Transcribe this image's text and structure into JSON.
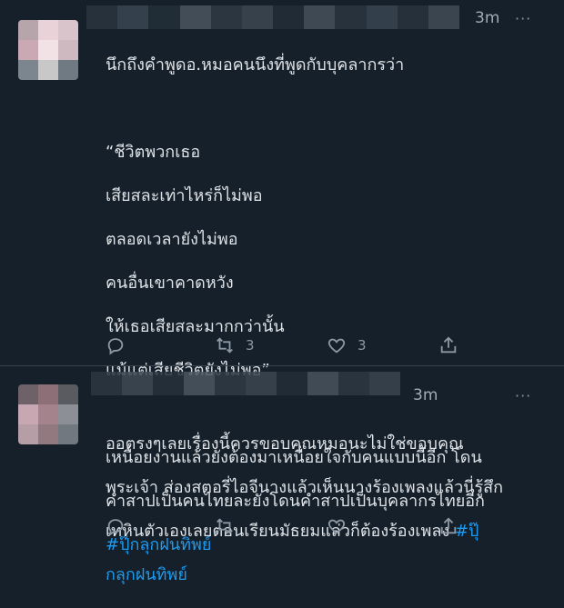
{
  "tweets": [
    {
      "time": "3m",
      "more": "···",
      "lines": [
        {
          "text": "นึกถึงคำพูดอ.หมอคนนึงที่พูดกับบุคลากรว่า"
        },
        {
          "text": ""
        },
        {
          "text": "“ชีวิตพวกเธอ"
        },
        {
          "text": "เสียสละเท่าไหร่ก็ไม่พอ"
        },
        {
          "text": "ตลอดเวลายังไม่พอ"
        },
        {
          "text": "คนอื่นเขาคาดหวัง"
        },
        {
          "text": "ให้เธอเสียสละมากกว่านั้น"
        },
        {
          "text": "แม้แต่เสียชีวิตยังไม่พอ”"
        },
        {
          "text": ""
        },
        {
          "text": "เหนื่อยงานแล้วยังต้องมาเหนื่อยใจกับคนแบบนี้อีก  โดน"
        },
        {
          "text": "คำสาปเป็นคนไทยละยังโดนคำสาปเป็นบุคลากรไทยอีก"
        },
        {
          "hashtag": "#ปุ๊กลุกฝนทิพย์"
        }
      ],
      "actions": {
        "reply": "",
        "retweet": "3",
        "like": "3"
      }
    },
    {
      "time": "3m",
      "more": "···",
      "lines": [
        {
          "text": "ออตรงๆเลยเรื่องนี้ควรขอบคุณหมอนะไม่ใช่ขอบคุณ"
        },
        {
          "text": "พระเจ้า ส่องสตอรี่ไอจีนางแล้วเห็นนางร้องเพลงแล้วนี่รู้สึก"
        },
        {
          "text": "เทหินตัวเองเลยตอนเรียนมัธยมแล่วก็ต้องร้องเพลง ",
          "hashtag": "#ปุ๊"
        },
        {
          "hashtag": "กลุกฝนทิพย์"
        }
      ],
      "actions": {
        "reply": "",
        "retweet": "",
        "like": ""
      }
    }
  ]
}
